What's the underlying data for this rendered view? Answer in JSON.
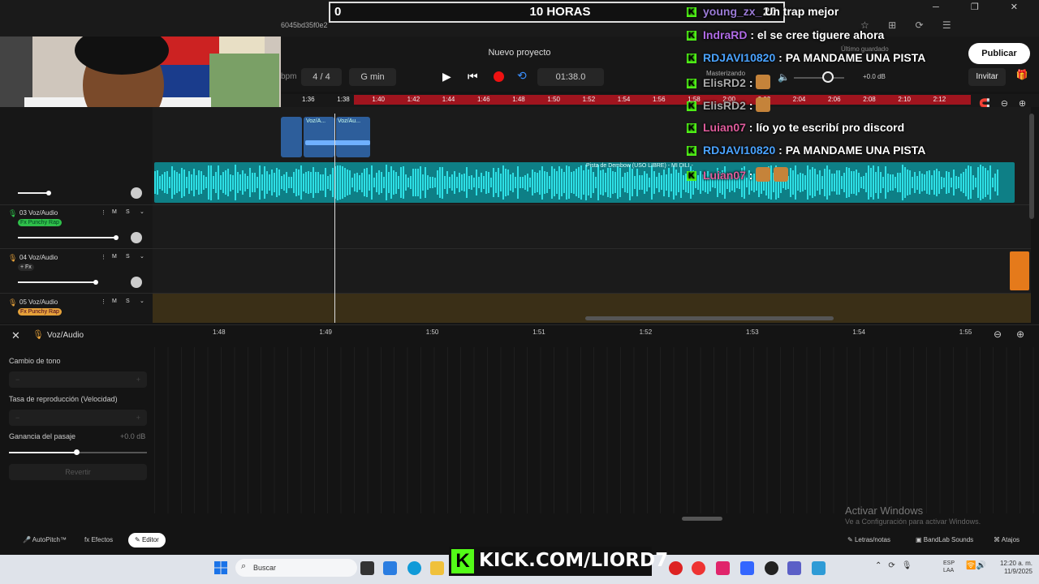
{
  "overlay": {
    "counter_left": "0",
    "counter_center": "10 HORAS",
    "counter_right": "20",
    "cam_score": "0",
    "project_hash": "6045bd35f0e2",
    "kick_url": "KICK.COM/LIORD7"
  },
  "chat": [
    {
      "user": "young_zx_",
      "message": "Un trap mejor",
      "user_color": "#9b7bd6"
    },
    {
      "user": "IndraRD",
      "message": ": el se cree tiguere ahora",
      "user_color": "#b06be6"
    },
    {
      "user": "RDJAVI10820",
      "message": ": PA MANDAME UNA PISTA",
      "user_color": "#4aa3ff"
    },
    {
      "user": "ElisRD2",
      "message": ":",
      "user_color": "#aaa"
    },
    {
      "user": "ElisRD2",
      "message": ":",
      "user_color": "#aaa"
    },
    {
      "user": "Luian07",
      "message": ": lío yo te escribí pro discord",
      "user_color": "#e05c9c"
    },
    {
      "user": "RDJAVI10820",
      "message": ": PA MANDAME UNA PISTA",
      "user_color": "#4aa3ff"
    },
    {
      "user": "Luian07",
      "message": ":",
      "user_color": "#e05c9c"
    }
  ],
  "daw": {
    "project_name": "Nuevo proyecto",
    "bpm_label": "bpm",
    "time_signature": "4 / 4",
    "key": "G min",
    "time": "01:38.0",
    "master_label": "Masterizando",
    "volume_db": "+0.0 dB",
    "saved_label": "Último guardado",
    "publish_label": "Publicar",
    "invite_label": "Invitar",
    "ruler_ticks": [
      "1:36",
      "1:38",
      "1:40",
      "1:42",
      "1:44",
      "1:46",
      "1:48",
      "1:50",
      "1:52",
      "1:54",
      "1:56",
      "1:58",
      "2:00",
      "2:02",
      "2:04",
      "2:06",
      "2:08",
      "2:10",
      "2:12"
    ],
    "clips": {
      "voz1": "Voz/A...",
      "voz2": "Voz/Au...",
      "beat": "Pista de Dembow (USO LIBRE) - MI DILI -"
    },
    "tracks": [
      {
        "num": "03",
        "name": "Voz/Audio",
        "fx": "Fx Punchy Rap",
        "m": "M",
        "s": "S"
      },
      {
        "num": "04",
        "name": "Voz/Audio",
        "fx": "+ Fx",
        "m": "M",
        "s": "S"
      },
      {
        "num": "05",
        "name": "Voz/Audio",
        "fx": "Fx Punchy Rap",
        "m": "M",
        "s": "S"
      }
    ]
  },
  "editor": {
    "title": "Voz/Audio",
    "ticks": [
      "1:48",
      "1:49",
      "1:50",
      "1:51",
      "1:52",
      "1:53",
      "1:54",
      "1:55"
    ],
    "pitch_label": "Cambio de tono",
    "rate_label": "Tasa de reproducción (Velocidad)",
    "gain_label": "Ganancia del pasaje",
    "gain_value": "+0.0 dB",
    "gain_level": 0.49,
    "revert_label": "Revertir",
    "minus": "−",
    "plus": "+"
  },
  "bottom": {
    "autopitch": "AutoPitch™",
    "efectos": "Efectos",
    "editor": "Editor",
    "letras": "Letras/notas",
    "bandlab": "BandLab Sounds",
    "atajos": "Atajos"
  },
  "windows": {
    "activate_title": "Activar Windows",
    "activate_sub": "Ve a Configuración para activar Windows.",
    "search_placeholder": "Buscar",
    "lang_1": "ESP",
    "lang_2": "LAA",
    "time": "12:20 a. m.",
    "date": "11/9/2025"
  },
  "colors": {
    "accent_red": "#a0141e",
    "wave_teal": "#2ee0e6",
    "fx_green": "#2fbf4a",
    "fx_orange": "#e5a13a",
    "kick_green": "#53fc18"
  }
}
